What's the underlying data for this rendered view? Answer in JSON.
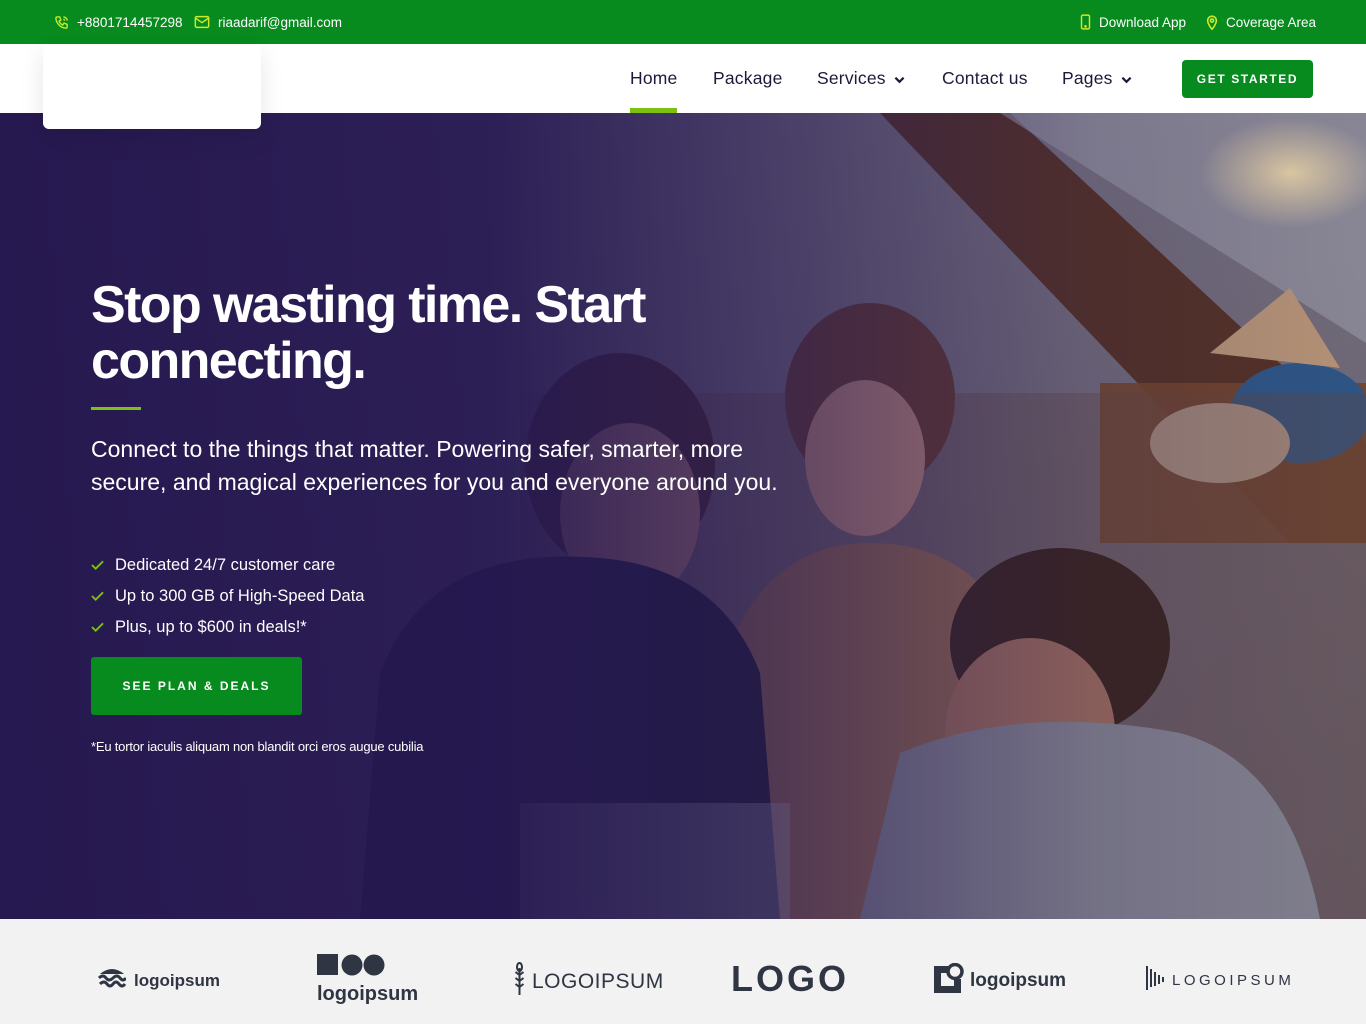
{
  "topbar": {
    "phone": "+8801714457298",
    "email": "riaadarif@gmail.com",
    "download_app": "Download App",
    "coverage_area": "Coverage Area"
  },
  "nav": {
    "items": [
      {
        "label": "Home",
        "active": true
      },
      {
        "label": "Package"
      },
      {
        "label": "Services",
        "has_dropdown": true
      },
      {
        "label": "Contact us"
      },
      {
        "label": "Pages",
        "has_dropdown": true
      }
    ],
    "cta": "GET STARTED"
  },
  "hero": {
    "title": "Stop wasting time. Start connecting.",
    "lead": "Connect to the things that matter. Powering safer, smarter, more secure, and magical experiences for you and everyone around you.",
    "features": [
      "Dedicated 24/7 customer care",
      "Up to 300 GB of High-Speed Data",
      "Plus, up to $600 in deals!*"
    ],
    "button": "SEE PLAN & DEALS",
    "footnote": "*Eu tortor iaculis aliquam non blandit orci eros augue cubilia"
  },
  "logos": {
    "items": [
      "logoipsum",
      "logoipsum",
      "LOGOIPSUM",
      "LOGO",
      "logoipsum",
      "LOGOIPSUM"
    ]
  },
  "colors": {
    "primary_green": "#078a1e",
    "accent_lime": "#7cc10f",
    "hero_overlay": "#23154e",
    "nav_text": "#1c1a3a",
    "logo_strip_bg": "#f2f2f3"
  }
}
